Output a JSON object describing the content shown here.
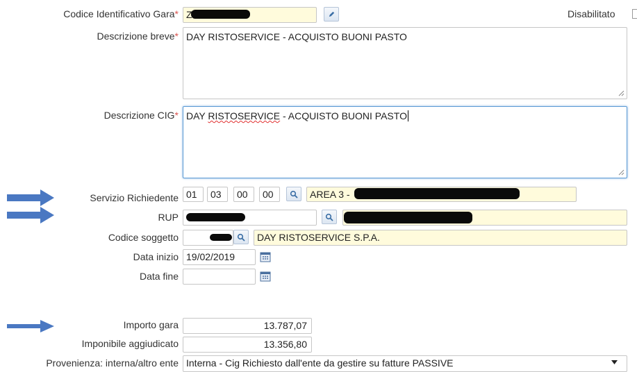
{
  "codice_gara": {
    "label": "Codice Identificativo Gara",
    "required": "*",
    "value": "Z"
  },
  "disabilitato": {
    "label": "Disabilitato"
  },
  "descrizione_breve": {
    "label": "Descrizione breve",
    "required": "*",
    "value": "DAY RISTOSERVICE - ACQUISTO BUONI PASTO"
  },
  "descrizione_cig": {
    "label": "Descrizione CIG",
    "required": "*",
    "value_prefix": "DAY ",
    "value_spell": "RISTOSERVICE",
    "value_suffix": " - ACQUISTO BUONI PASTO"
  },
  "servizio": {
    "label": "Servizio Richiedente",
    "codes": [
      "01",
      "03",
      "00",
      "00"
    ],
    "desc": "AREA 3 -"
  },
  "rup": {
    "label": "RUP",
    "value": "",
    "desc": ""
  },
  "codice_soggetto": {
    "label": "Codice soggetto",
    "value": "",
    "desc": "DAY RISTOSERVICE S.P.A."
  },
  "data_inizio": {
    "label": "Data inizio",
    "value": "19/02/2019"
  },
  "data_fine": {
    "label": "Data fine",
    "value": ""
  },
  "importo_gara": {
    "label": "Importo gara",
    "value": "13.787,07"
  },
  "imponibile": {
    "label": "Imponibile aggiudicato",
    "value": "13.356,80"
  },
  "provenienza": {
    "label": "Provenienza: interna/altro ente",
    "value": "Interna - Cig Richiesto dall'ente da gestire su fatture PASSIVE"
  },
  "icons": {
    "edit": "pencil-icon",
    "search": "magnifier-icon",
    "calendar": "calendar-icon",
    "dropdown": "caret-down-icon",
    "annotation": "arrow-right-icon"
  },
  "colors": {
    "readonly_bg": "#fffbdc",
    "required": "#d9534f",
    "focus_border": "#5b9bd5",
    "arrow": "#4a78c2"
  }
}
